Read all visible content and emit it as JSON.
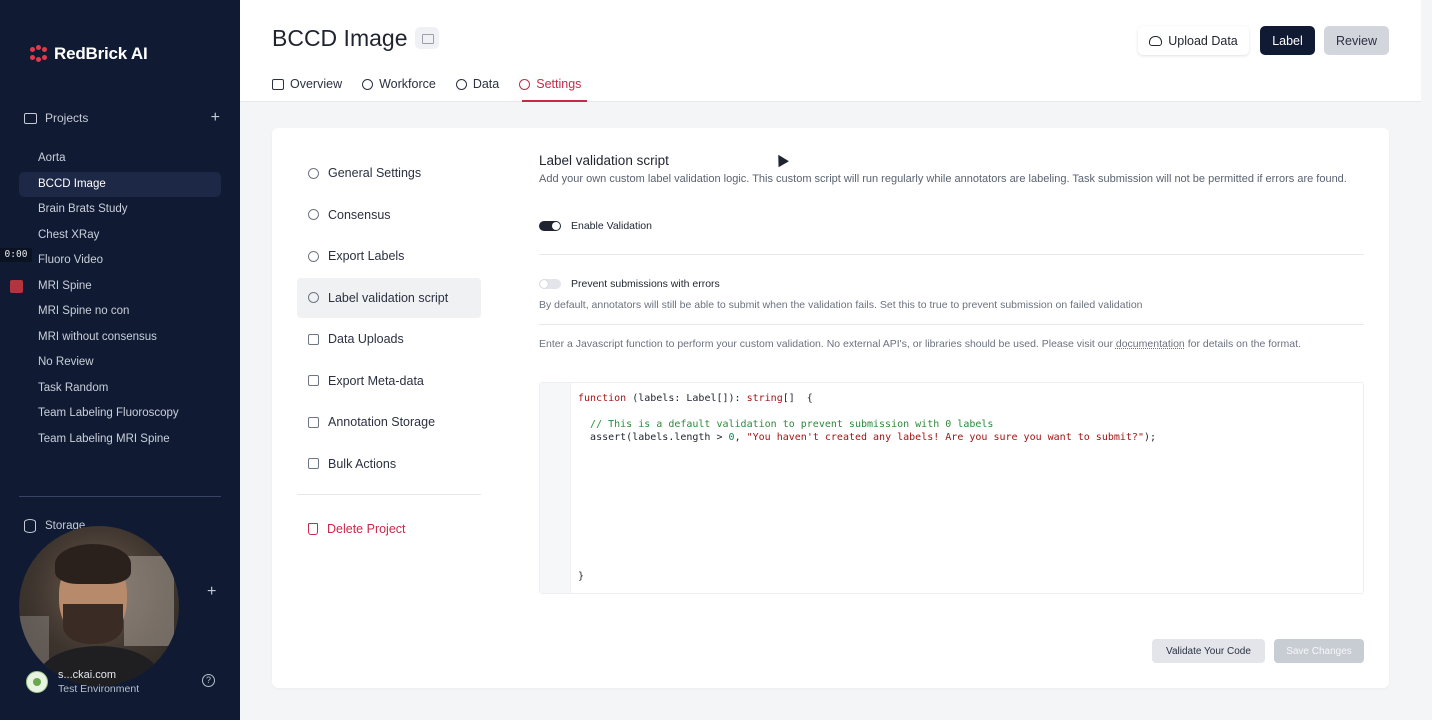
{
  "app": {
    "brand": "RedBrick AI",
    "accent_color": "#c42b4a",
    "sidebar_color": "#101b33"
  },
  "sidebar": {
    "projects_label": "Projects",
    "add_icon": "plus-icon",
    "projects": [
      {
        "label": "Aorta",
        "active": false
      },
      {
        "label": "BCCD Image",
        "active": true
      },
      {
        "label": "Brain Brats Study",
        "active": false
      },
      {
        "label": "Chest XRay",
        "active": false
      },
      {
        "label": "Fluoro Video",
        "active": false
      },
      {
        "label": "MRI Spine",
        "active": false
      },
      {
        "label": "MRI Spine no con",
        "active": false
      },
      {
        "label": "MRI without consensus",
        "active": false
      },
      {
        "label": "No Review",
        "active": false
      },
      {
        "label": "Task Random",
        "active": false
      },
      {
        "label": "Team Labeling Fluoroscopy",
        "active": false
      },
      {
        "label": "Team Labeling MRI Spine",
        "active": false
      }
    ],
    "recording_time": "0:00",
    "storage_label": "Storage",
    "user_email": "s...ckai.com",
    "user_env": "Test Environment",
    "help_glyph": "?"
  },
  "header": {
    "title": "BCCD Image",
    "upload_label": "Upload Data",
    "label_label": "Label",
    "review_label": "Review",
    "tabs": [
      {
        "label": "Overview",
        "icon": "folder-icon"
      },
      {
        "label": "Workforce",
        "icon": "user-icon"
      },
      {
        "label": "Data",
        "icon": "data-icon"
      },
      {
        "label": "Settings",
        "icon": "gear-icon",
        "active": true
      }
    ]
  },
  "settings_nav": {
    "items": [
      {
        "label": "General Settings",
        "icon": "gear-icon"
      },
      {
        "label": "Consensus",
        "icon": "consensus-icon"
      },
      {
        "label": "Export Labels",
        "icon": "export-icon"
      },
      {
        "label": "Label validation script",
        "icon": "script-icon",
        "active": true
      },
      {
        "label": "Data Uploads",
        "icon": "database-icon"
      },
      {
        "label": "Export Meta-data",
        "icon": "file-icon"
      },
      {
        "label": "Annotation Storage",
        "icon": "storage-icon"
      },
      {
        "label": "Bulk Actions",
        "icon": "layers-icon"
      }
    ],
    "delete_label": "Delete Project"
  },
  "validation": {
    "title": "Label validation script",
    "description": "Add your own custom label validation logic. This custom script will run regularly while annotators are labeling. Task submission will not be permitted if errors are found.",
    "enable_label": "Enable Validation",
    "enable_on": true,
    "prevent_label": "Prevent submissions with errors",
    "prevent_on": false,
    "prevent_desc": "By default, annotators will still be able to submit when the validation fails. Set this to true to prevent submission on failed validation",
    "instructions_pre": "Enter a Javascript function to perform your custom validation. No external API's, or libraries should be used. Please visit our",
    "doc_link": "documentation",
    "instructions_post": "for details on the format.",
    "code_line1_kw": "function",
    "code_line1_mid": " (labels: Label[]): ",
    "code_line1_type": "string",
    "code_line1_end": "[]  {",
    "code_comment": "// This is a default validation to prevent submission with 0 labels",
    "code_line3_a": "assert(labels.length > ",
    "code_line3_num": "0",
    "code_line3_b": ", ",
    "code_line3_str": "\"You haven't created any labels! Are you sure you want to submit?\"",
    "code_line3_c": ");",
    "code_close": "}",
    "validate_label": "Validate Your Code",
    "save_label": "Save Changes"
  }
}
